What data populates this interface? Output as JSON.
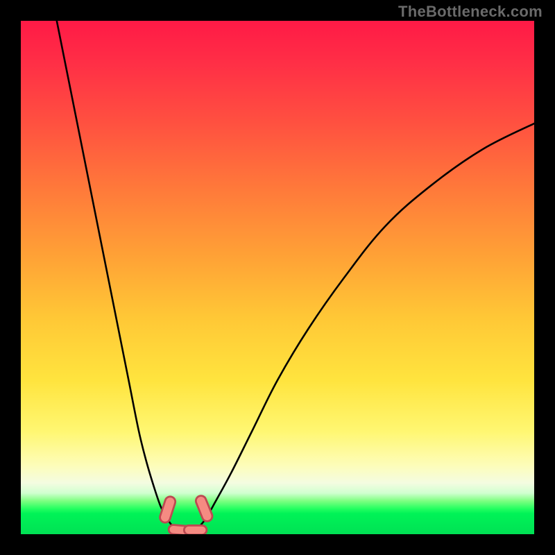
{
  "watermark": "TheBottleneck.com",
  "chart_data": {
    "type": "line",
    "title": "",
    "xlabel": "",
    "ylabel": "",
    "xlim": [
      0,
      100
    ],
    "ylim": [
      0,
      100
    ],
    "series": [
      {
        "name": "left-curve",
        "x": [
          7,
          9,
          11,
          13,
          15,
          17,
          19,
          21,
          23,
          24.5,
          26,
          27.2,
          28.2,
          29.2,
          30.0
        ],
        "y": [
          100,
          90,
          80,
          70,
          60,
          50,
          40,
          30,
          20,
          14,
          9,
          5.5,
          3.5,
          2.0,
          1.2
        ]
      },
      {
        "name": "right-curve",
        "x": [
          34.5,
          36,
          38,
          41,
          45,
          50,
          56,
          63,
          71,
          80,
          90,
          100
        ],
        "y": [
          1.2,
          3.0,
          6.5,
          12,
          20,
          30,
          40,
          50,
          60,
          68,
          75,
          80
        ]
      }
    ],
    "markers": [
      {
        "name": "floor-pill-left",
        "x": 31.0,
        "y": 0.8,
        "rx": 2.2,
        "ry": 0.9,
        "angle": 5,
        "color": "#f58b82"
      },
      {
        "name": "floor-pill-right",
        "x": 34.0,
        "y": 0.8,
        "rx": 2.2,
        "ry": 0.9,
        "angle": 0,
        "color": "#f58b82"
      },
      {
        "name": "curve-pill-left",
        "x": 28.6,
        "y": 4.8,
        "rx": 1.0,
        "ry": 2.6,
        "angle": 18,
        "color": "#f58b82"
      },
      {
        "name": "curve-pill-right",
        "x": 35.7,
        "y": 5.0,
        "rx": 1.0,
        "ry": 2.6,
        "angle": -22,
        "color": "#f58b82"
      }
    ],
    "background_gradient": {
      "dir": "top-to-bottom",
      "stops": [
        {
          "pct": 0,
          "color": "#ff1a46"
        },
        {
          "pct": 33,
          "color": "#ff7a3a"
        },
        {
          "pct": 70,
          "color": "#ffe43e"
        },
        {
          "pct": 90,
          "color": "#f4fce1"
        },
        {
          "pct": 95,
          "color": "#26ff61"
        },
        {
          "pct": 100,
          "color": "#00e154"
        }
      ]
    }
  }
}
